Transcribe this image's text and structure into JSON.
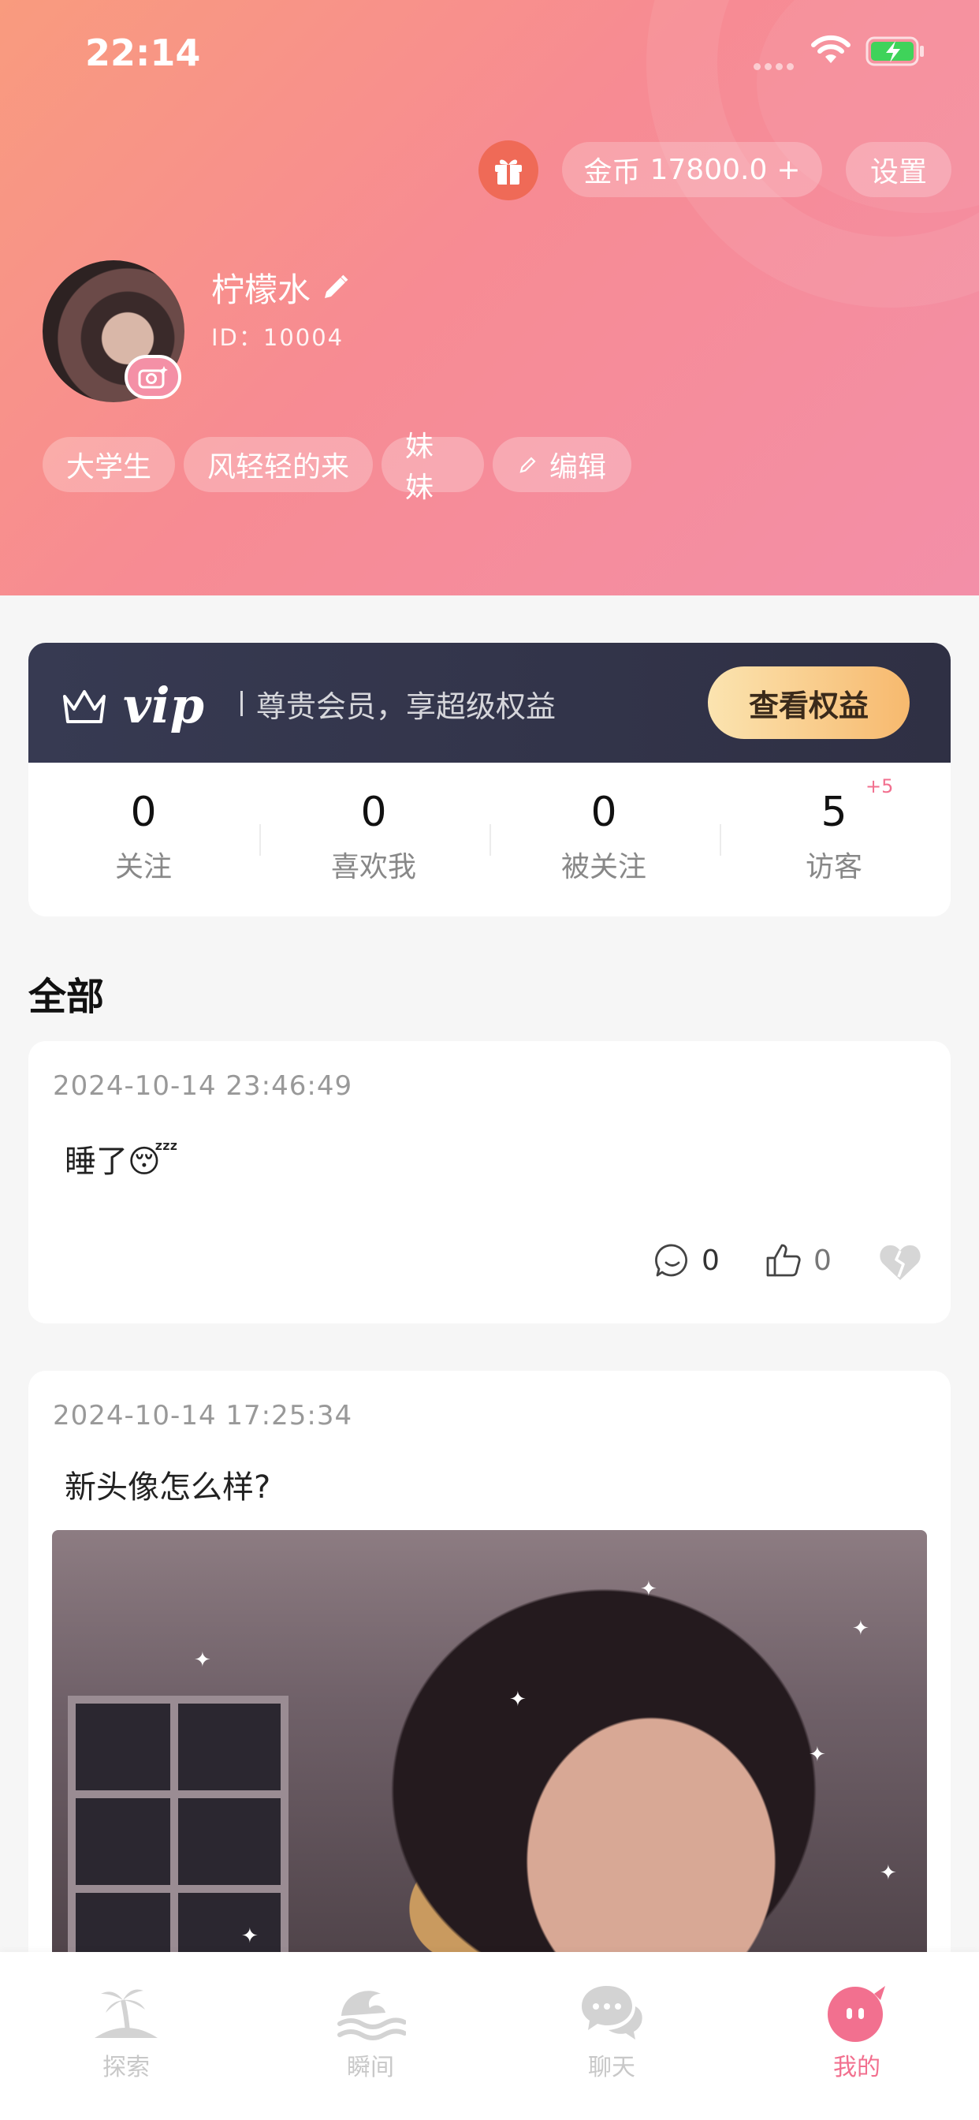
{
  "status_bar": {
    "time": "22:14"
  },
  "header": {
    "coin_label": "金币",
    "coin_amount": "17800.0",
    "coin_plus": "+",
    "settings_label": "设置"
  },
  "profile": {
    "nickname": "柠檬水",
    "id_text": "ID：10004",
    "tags": [
      "大学生",
      "风轻轻的来",
      "妹妹"
    ],
    "edit_label": "编辑"
  },
  "vip": {
    "logo_text": "vip",
    "slogan": "尊贵会员，享超级权益",
    "button_label": "查看权益"
  },
  "stats": [
    {
      "value": "0",
      "label": "关注"
    },
    {
      "value": "0",
      "label": "喜欢我"
    },
    {
      "value": "0",
      "label": "被关注"
    },
    {
      "value": "5",
      "label": "访客"
    }
  ],
  "visitor_badge": "+5",
  "section_title": "全部",
  "posts": [
    {
      "time": "2024-10-14 23:46:49",
      "text": "睡了😴",
      "comments": "0",
      "likes": "0"
    },
    {
      "time": "2024-10-14 17:25:34",
      "text": "新头像怎么样?"
    }
  ],
  "tabs": [
    {
      "label": "探索",
      "icon": "island-icon"
    },
    {
      "label": "瞬间",
      "icon": "wave-icon"
    },
    {
      "label": "聊天",
      "icon": "chat-bubbles-icon"
    },
    {
      "label": "我的",
      "icon": "me-face-icon",
      "active": true
    }
  ],
  "colors": {
    "accent": "#f2708f",
    "vip_dark": "#33354b",
    "vip_gold": "#f7b96e"
  }
}
